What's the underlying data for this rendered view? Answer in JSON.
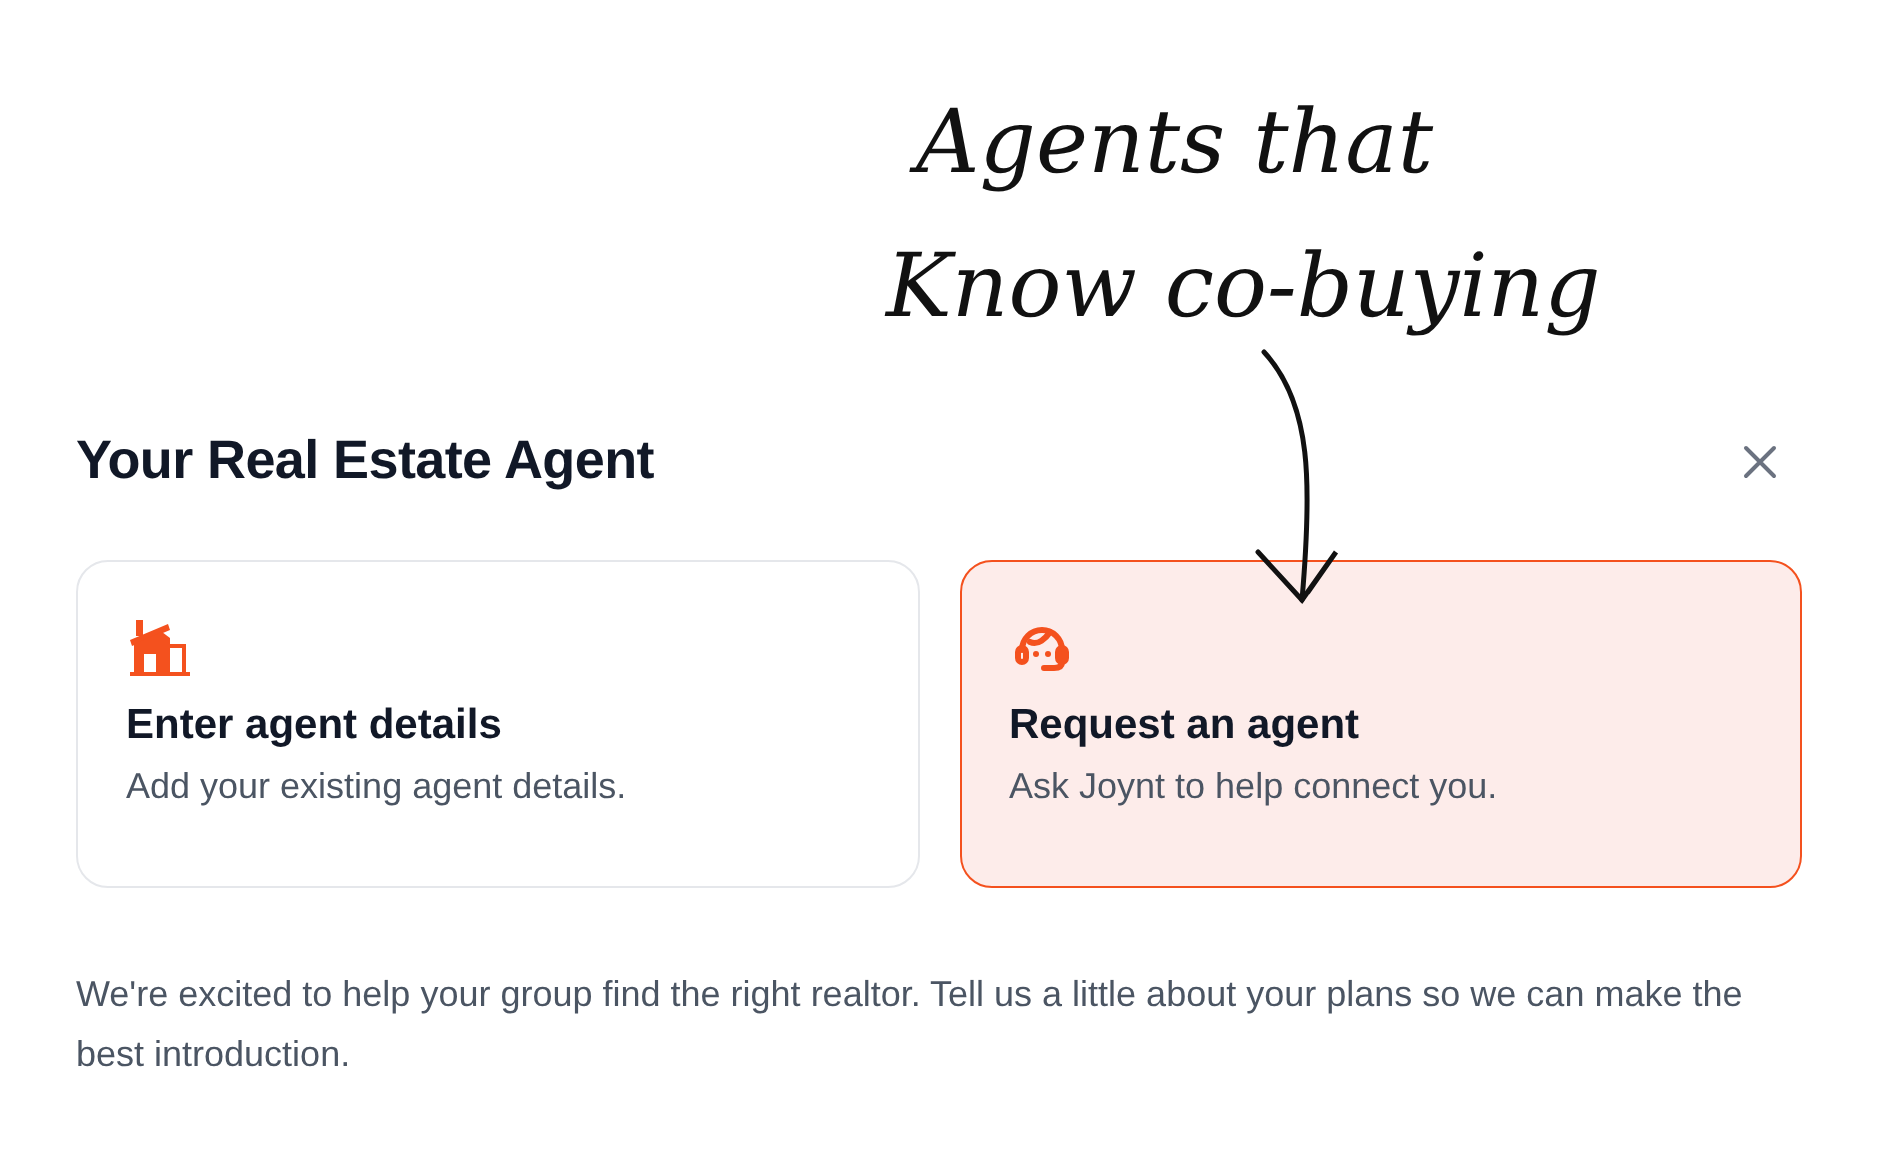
{
  "annotation": {
    "lines": [
      "Agents that",
      "Know co-buying"
    ]
  },
  "dialog": {
    "title": "Your Real Estate Agent",
    "options": [
      {
        "kind": "house",
        "title": "Enter agent details",
        "description": "Add your existing agent details.",
        "selected": false
      },
      {
        "kind": "headset",
        "title": "Request an agent",
        "description": "Ask Joynt to help connect you.",
        "selected": true
      }
    ],
    "message": "We're excited to help your group find the right realtor. Tell us a little about your plans so we can make the best introduction."
  }
}
